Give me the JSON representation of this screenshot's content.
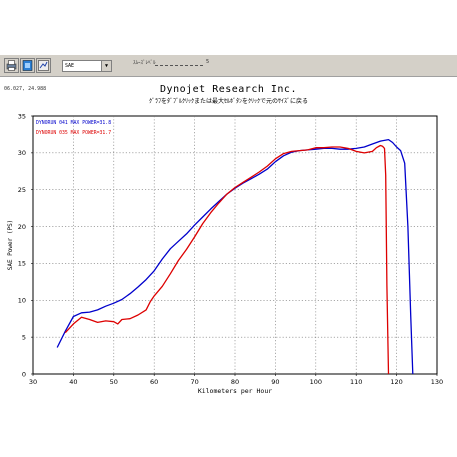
{
  "toolbar": {
    "icons": [
      "print-icon",
      "copy-icon",
      "zoom-icon"
    ],
    "select_value": "SAE",
    "select_arrow": "▼",
    "option_label": "ｽﾑｰｽﾞﾚﾍﾞﾙ",
    "option_value": "5"
  },
  "coord_readout": "06.027, 24.988",
  "title": "Dynojet  Research  Inc.",
  "subtitle": "ｸﾞﾗﾌをﾀﾞﾌﾞﾙｸﾘｯｸまたは最大ｾﾙﾎﾞﾀﾝをｸﾘｯｸで元のｻｲｽﾞに戻る",
  "chart_data": {
    "type": "line",
    "xlabel": "Kilometers per Hour",
    "ylabel": "SAE Power (PS)",
    "xlim": [
      30,
      130
    ],
    "ylim": [
      0,
      35
    ],
    "xticks": [
      30,
      40,
      50,
      60,
      70,
      80,
      90,
      100,
      110,
      120,
      130
    ],
    "yticks": [
      0,
      5,
      10,
      15,
      20,
      25,
      30,
      35
    ],
    "grid": true,
    "legend_position": "top-left",
    "series": [
      {
        "name": "DYNORUN 041  MAX POWER=31.8",
        "color": "#0000cc",
        "x": [
          36,
          38,
          40,
          42,
          44,
          46,
          48,
          50,
          52,
          54,
          56,
          58,
          60,
          62,
          64,
          66,
          68,
          70,
          72,
          74,
          76,
          78,
          80,
          82,
          84,
          86,
          88,
          90,
          92,
          94,
          96,
          98,
          100,
          102,
          104,
          106,
          108,
          110,
          112,
          114,
          116,
          118,
          119,
          120,
          121,
          122,
          122.8,
          123.5,
          124
        ],
        "y": [
          3.6,
          5.8,
          7.8,
          8.3,
          8.4,
          8.7,
          9.2,
          9.6,
          10.1,
          10.9,
          11.8,
          12.8,
          14.0,
          15.6,
          17.0,
          18.0,
          19.0,
          20.2,
          21.3,
          22.4,
          23.4,
          24.4,
          25.2,
          25.9,
          26.5,
          27.1,
          27.8,
          28.8,
          29.6,
          30.1,
          30.3,
          30.4,
          30.5,
          30.6,
          30.6,
          30.5,
          30.5,
          30.6,
          30.8,
          31.2,
          31.6,
          31.8,
          31.4,
          30.8,
          30.3,
          28.6,
          20.0,
          8.0,
          0.0
        ]
      },
      {
        "name": "DYNORUN 035  MAX POWER=31.7",
        "color": "#dd0000",
        "x": [
          38,
          40,
          42,
          44,
          46,
          48,
          50,
          51,
          52,
          54,
          56,
          58,
          59,
          60,
          62,
          64,
          66,
          68,
          70,
          72,
          74,
          76,
          78,
          80,
          82,
          84,
          86,
          88,
          90,
          92,
          94,
          96,
          98,
          100,
          102,
          104,
          106,
          108,
          110,
          112,
          114,
          115,
          116,
          116.5,
          117,
          117.3,
          117.6,
          118
        ],
        "y": [
          5.6,
          6.8,
          7.7,
          7.4,
          7.0,
          7.2,
          7.1,
          6.8,
          7.4,
          7.5,
          8.0,
          8.7,
          9.8,
          10.6,
          11.9,
          13.6,
          15.4,
          16.9,
          18.6,
          20.4,
          21.9,
          23.2,
          24.4,
          25.3,
          26.0,
          26.7,
          27.4,
          28.2,
          29.2,
          29.9,
          30.2,
          30.3,
          30.4,
          30.7,
          30.7,
          30.8,
          30.8,
          30.6,
          30.2,
          30.0,
          30.2,
          30.7,
          31.0,
          30.9,
          30.6,
          27.0,
          12.0,
          0.0
        ]
      }
    ]
  }
}
